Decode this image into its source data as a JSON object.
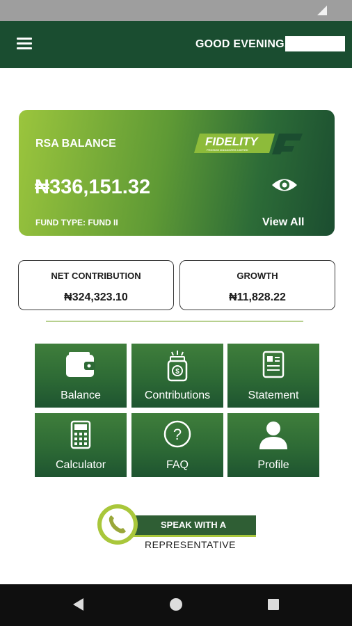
{
  "appbar": {
    "greeting": "GOOD EVENING,"
  },
  "balance_card": {
    "label": "RSA BALANCE",
    "balance": "₦336,151.32",
    "fund_type": "FUND TYPE: FUND II",
    "view_all": "View All",
    "logo_text": "FIDELITY",
    "logo_subtext": "PENSION MANAGERS LIMITED"
  },
  "stats": [
    {
      "label": "NET CONTRIBUTION",
      "value": "₦324,323.10"
    },
    {
      "label": "GROWTH",
      "value": "₦11,828.22"
    }
  ],
  "tiles": [
    {
      "label": "Balance",
      "icon": "wallet-icon"
    },
    {
      "label": "Contributions",
      "icon": "money-jar-icon"
    },
    {
      "label": "Statement",
      "icon": "document-icon"
    },
    {
      "label": "Calculator",
      "icon": "calculator-icon"
    },
    {
      "label": "FAQ",
      "icon": "question-icon"
    },
    {
      "label": "Profile",
      "icon": "user-icon"
    }
  ],
  "speak": {
    "line1": "SPEAK WITH A",
    "line2": "REPRESENTATIVE"
  },
  "colors": {
    "brand_dark": "#1a4d30",
    "brand_light": "#9bc53d",
    "accent": "#a9c73b"
  }
}
